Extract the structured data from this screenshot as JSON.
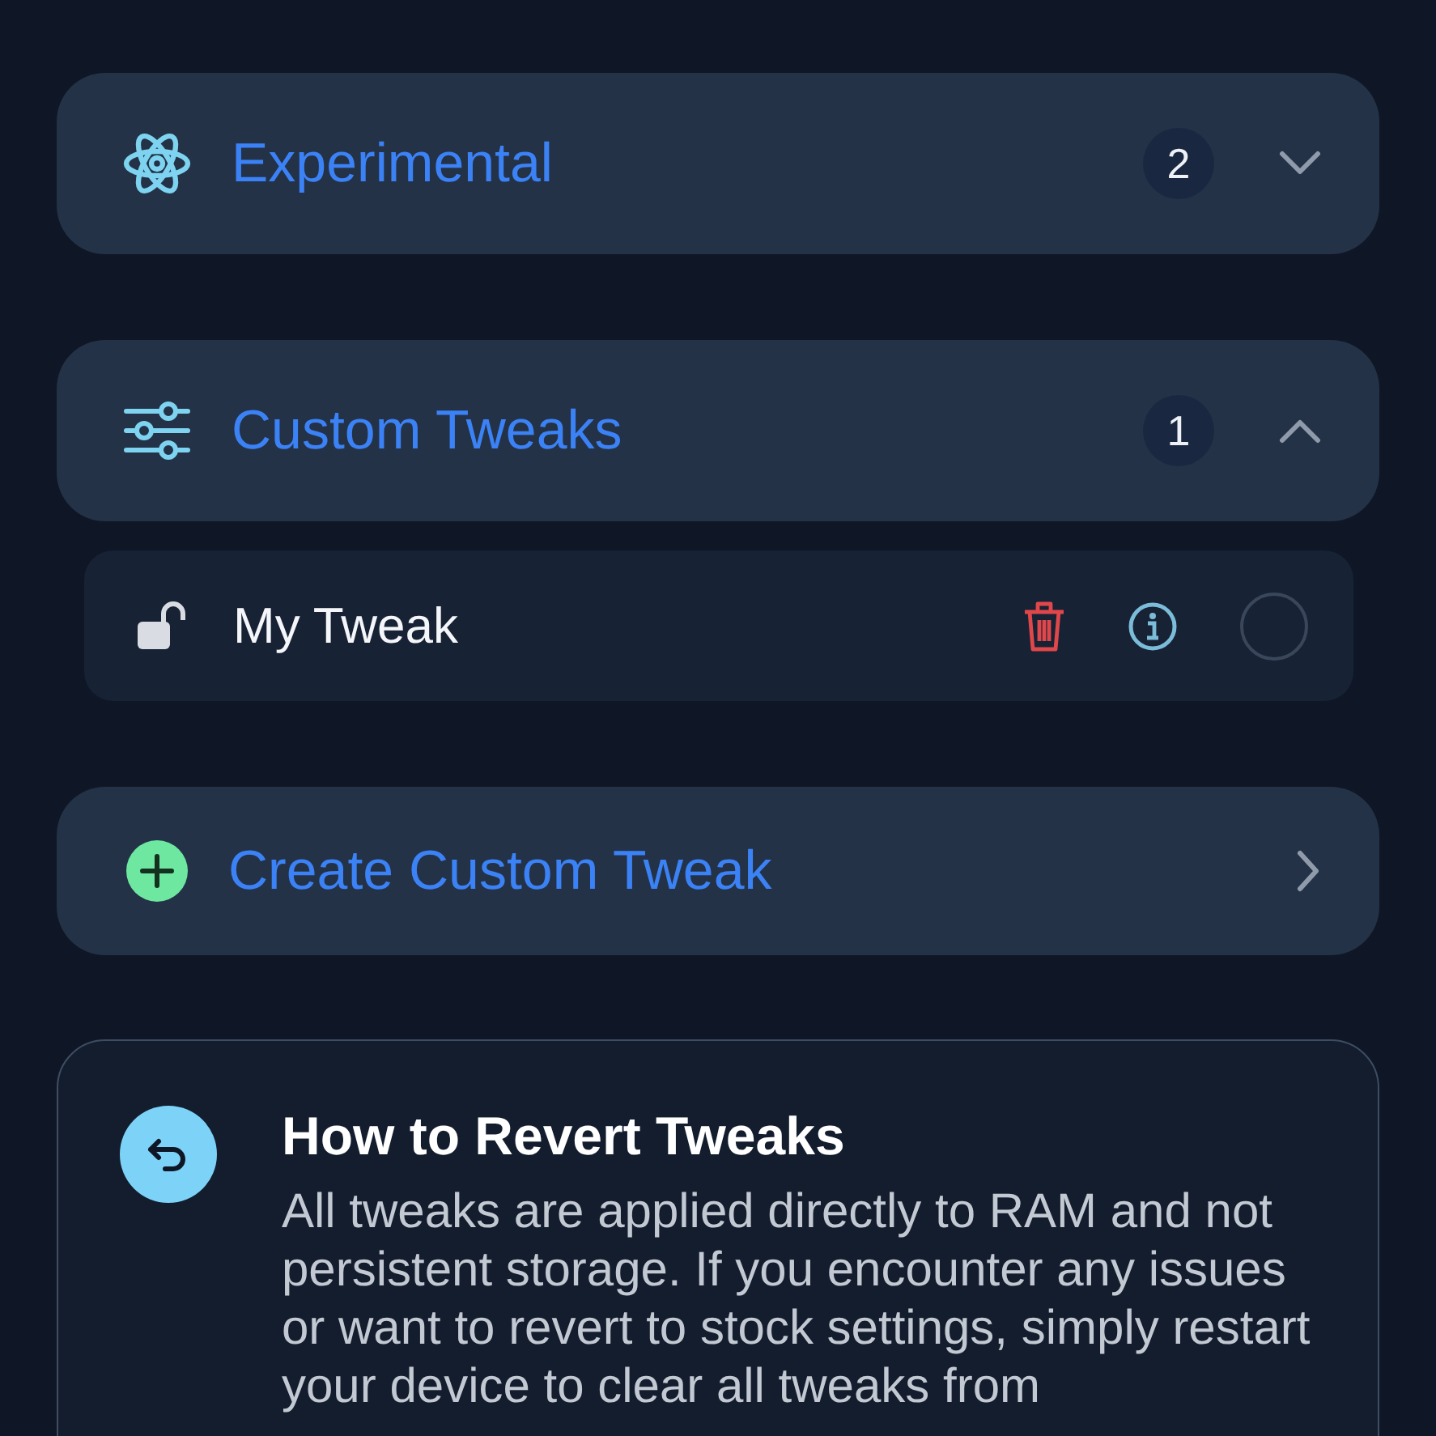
{
  "sections": [
    {
      "kind": "group",
      "title": "Experimental",
      "count": "2",
      "expanded": false
    },
    {
      "kind": "group",
      "title": "Custom Tweaks",
      "count": "1",
      "expanded": true,
      "items": [
        {
          "title": "My Tweak",
          "locked": false,
          "enabled": false
        }
      ]
    },
    {
      "kind": "action",
      "title": "Create Custom Tweak"
    }
  ],
  "info": {
    "title": "How to Revert Tweaks",
    "text": "All tweaks are applied directly to RAM and not persistent storage. If you encounter any issues or want to revert to stock settings, simply restart your device to clear all tweaks from"
  }
}
